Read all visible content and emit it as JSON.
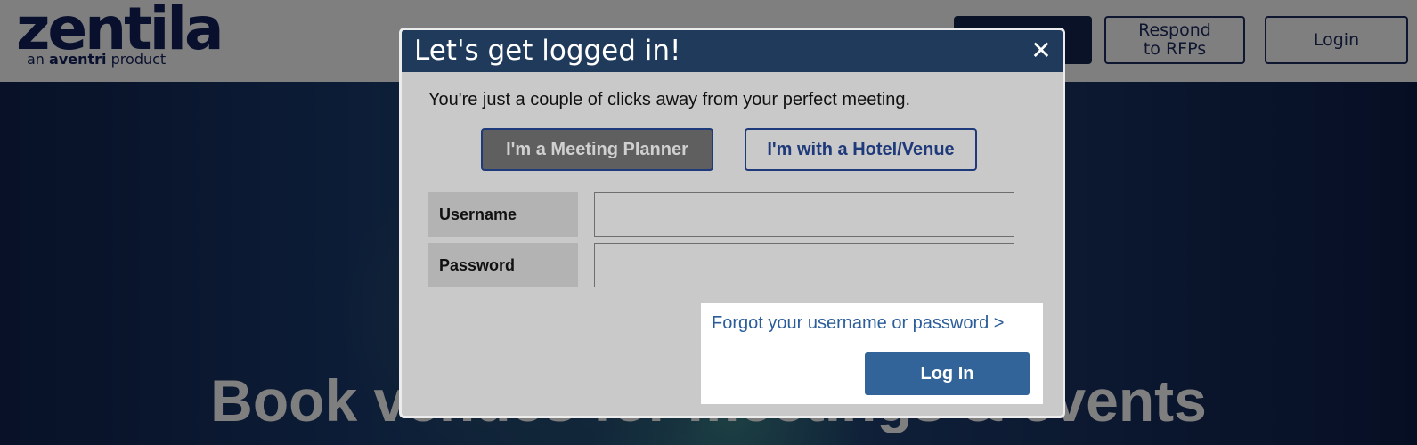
{
  "brand": {
    "logo_text": "zentila",
    "tagline_prefix": "an",
    "tagline_brand": "aventri",
    "tagline_suffix": "product",
    "color": "#13205a"
  },
  "header": {
    "buttons": [
      {
        "label": "",
        "style": "filled"
      },
      {
        "label_line1": "Respond",
        "label_line2": "to RFPs"
      },
      {
        "label": "Login"
      }
    ]
  },
  "hero": {
    "title": "Book venues for meetings & events"
  },
  "modal": {
    "title": "Let's get logged in!",
    "close_glyph": "✕",
    "subtitle": "You're just a couple of clicks away from your perfect meeting.",
    "roles": {
      "planner": "I'm a Meeting Planner",
      "venue": "I'm with a Hotel/Venue",
      "selected": "planner"
    },
    "fields": {
      "username_label": "Username",
      "username_value": "",
      "password_label": "Password",
      "password_value": ""
    },
    "forgot_link": "Forgot your username or password >",
    "submit_label": "Log In",
    "colors": {
      "header": "#1f3a5a",
      "body": "#c9c9c9",
      "primary": "#32649a",
      "link": "#2a5d9a"
    }
  }
}
